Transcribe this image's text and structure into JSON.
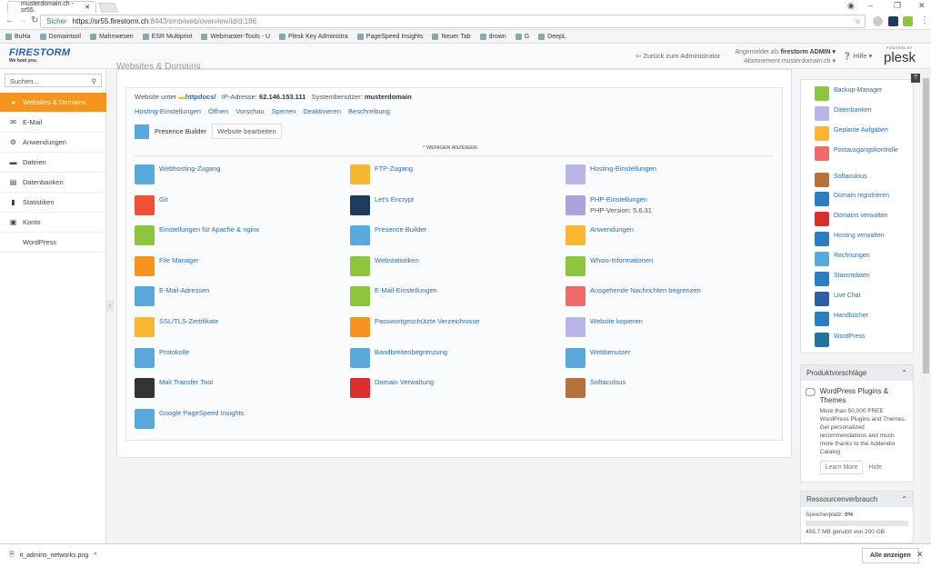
{
  "browser": {
    "tab_title": "musterdomain.ch - sr55.",
    "secure_label": "Sicher",
    "url_host": "https://sr55.firestorm.ch",
    "url_path": ":8443/smb/web/overview/id/d:186",
    "bookmarks": [
      "BuHa",
      "Domaintool",
      "Mahnwesen",
      "ESR Multiprint",
      "Webmaster-Tools - U",
      "Plesk Key Administra",
      "PageSpeed Insights",
      "Neuer Tab",
      "drown",
      "G",
      "DeepL"
    ]
  },
  "header": {
    "logo": "FIRESTORM",
    "slogan": "We host you.",
    "back": "Zurück zum Administrator",
    "logged_in_label": "Angemeldet als",
    "user": "firestorm ADMIN ▾",
    "subscription_label": "Abonnement",
    "subscription": "musterdomain.ch ▾",
    "help": "Hilfe ▾",
    "powered_by": "POWERED BY",
    "plesk": "plesk"
  },
  "sidebar": {
    "search_placeholder": "Suchen...",
    "items": [
      {
        "label": "Websites & Domains",
        "icon": "◕"
      },
      {
        "label": "E-Mail",
        "icon": "✉"
      },
      {
        "label": "Anwendungen",
        "icon": "⚙"
      },
      {
        "label": "Dateien",
        "icon": "▬"
      },
      {
        "label": "Datenbanken",
        "icon": "▤"
      },
      {
        "label": "Statistiken",
        "icon": "▮"
      },
      {
        "label": "Konto",
        "icon": "▣"
      },
      {
        "label": "WordPress",
        "icon": ""
      }
    ]
  },
  "main": {
    "page_title": "Websites & Domains",
    "info": {
      "website_label": "Website unter",
      "docroot": "httpdocs/",
      "ip_label": "IP-Adresse:",
      "ip": "62.146.153.111",
      "sysuser_label": "Systembenutzer:",
      "sysuser": "musterdomain"
    },
    "actions": [
      "Hosting-Einstellungen",
      "Öffnen",
      "Vorschau",
      "Sperren",
      "Deaktivieren",
      "Beschreibung"
    ],
    "presence_builder": "Presence Builder",
    "edit_website": "Website bearbeiten",
    "show_less": "^ WENIGER ANZEIGEN",
    "tools": [
      [
        {
          "label": "Webhosting-Zugang",
          "color": "#5aa9dd"
        },
        {
          "label": "Git",
          "color": "#f05133"
        },
        {
          "label": "Einstellungen für Apache & nginx",
          "color": "#8cc63f"
        },
        {
          "label": "File Manager",
          "color": "#f7941d"
        },
        {
          "label": "E-Mail-Adressen",
          "color": "#5aa9dd"
        },
        {
          "label": "SSL/TLS-Zertifikate",
          "color": "#f7b731"
        },
        {
          "label": "Protokolle",
          "color": "#5aa9dd"
        },
        {
          "label": "Mail Transfer Tool",
          "color": "#333333"
        },
        {
          "label": "Google PageSpeed Insights",
          "color": "#5aa9dd"
        }
      ],
      [
        {
          "label": "FTP-Zugang",
          "color": "#f7b731"
        },
        {
          "label": "Let's Encrypt",
          "color": "#1f3b5c"
        },
        {
          "label": "Presence Builder",
          "color": "#5aa9dd"
        },
        {
          "label": "Webstatistiken",
          "color": "#8cc63f"
        },
        {
          "label": "E-Mail-Einstellungen",
          "color": "#8cc63f"
        },
        {
          "label": "Passwortgeschützte Verzeichnisse",
          "color": "#f7941d"
        },
        {
          "label": "Bandbreitenbegrenzung",
          "color": "#5aa9dd"
        },
        {
          "label": "Domain Verwaltung",
          "color": "#d9302c"
        }
      ],
      [
        {
          "label": "Hosting-Einstellungen",
          "color": "#b9b5e6"
        },
        {
          "label": "PHP-Einstellungen",
          "sub": "PHP-Version: 5.6.31",
          "color": "#a9a3db"
        },
        {
          "label": "Anwendungen",
          "color": "#f7b731"
        },
        {
          "label": "Whois-Informationen",
          "color": "#8cc63f"
        },
        {
          "label": "Ausgehende Nachrichten begrenzen",
          "color": "#ee6b6b"
        },
        {
          "label": "Website kopieren",
          "color": "#b9b5e6"
        },
        {
          "label": "Webbenutzer",
          "color": "#5aa9dd"
        },
        {
          "label": "Softaculous",
          "color": "#b5733a"
        }
      ]
    ]
  },
  "right": {
    "help": "?",
    "items": [
      {
        "label": "Backup-Manager",
        "color": "#8cc63f"
      },
      {
        "label": "Datenbanken",
        "color": "#b9b5e6"
      },
      {
        "label": "Geplante Aufgaben",
        "color": "#f7b731"
      },
      {
        "label": "Postausgangskontrolle",
        "color": "#ee6b6b"
      },
      {
        "label": "Softaculous",
        "color": "#b5733a"
      },
      {
        "label": "Domain registrieren",
        "color": "#2a7fc0"
      },
      {
        "label": "Domains verwalten",
        "color": "#d9302c"
      },
      {
        "label": "Hosting verwalten",
        "color": "#2a7fc0"
      },
      {
        "label": "Rechnungen",
        "color": "#5aa9dd"
      },
      {
        "label": "Stammdaten",
        "color": "#2a7fc0"
      },
      {
        "label": "Live Chat",
        "color": "#2a5fa8"
      },
      {
        "label": "Handbücher",
        "color": "#2a7fc0"
      },
      {
        "label": "WordPress",
        "color": "#21759b"
      }
    ],
    "suggest": {
      "title": "Produktvorschläge",
      "item_title": "WordPress Plugins & Themes",
      "text": "More than 50,000 FREE WordPress Plugins and Themes. Get personalized recommendations and much more thanks to the Addendio Catalog",
      "learn": "Learn More",
      "hide": "Hide"
    },
    "resources": {
      "title": "Ressourcenverbrauch",
      "disk_label": "Speicherplatz:",
      "disk_pct": "0%",
      "disk_value": 0,
      "disk_text": "455.7 MB genutzt von 200 GB"
    }
  },
  "downloads": {
    "file": "it_admins_networks.png",
    "show_all": "Alle anzeigen"
  }
}
